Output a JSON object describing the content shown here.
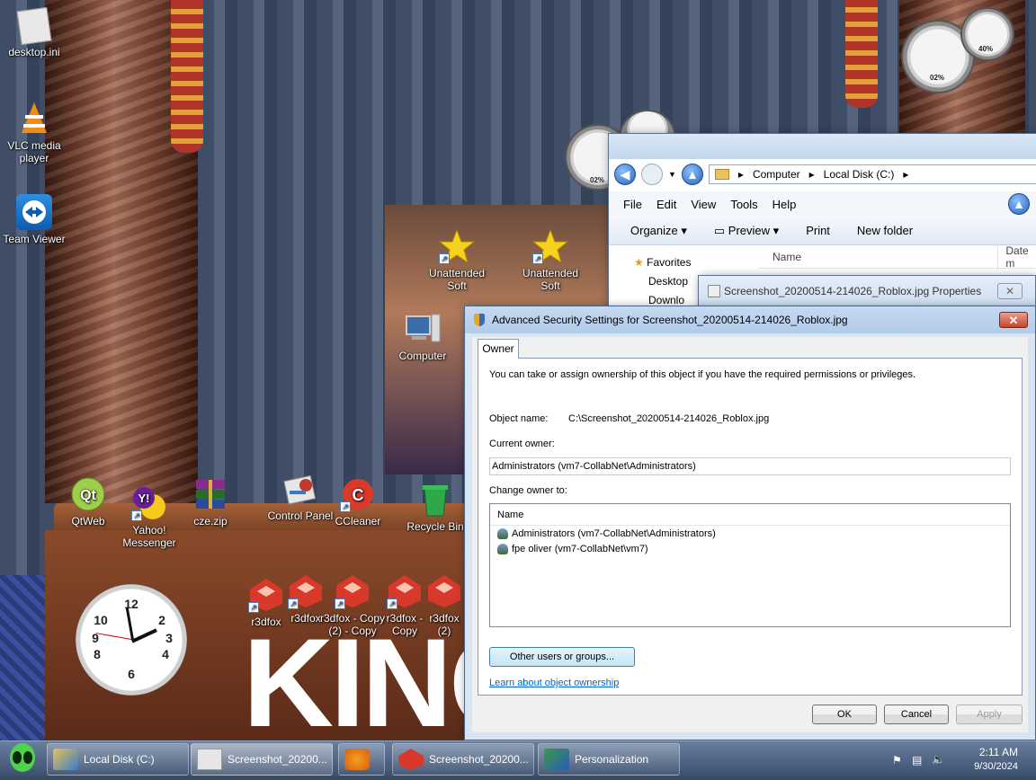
{
  "desktop": {
    "icons": [
      {
        "label": "desktop.ini"
      },
      {
        "label": "VLC media player"
      },
      {
        "label": "Team Viewer"
      },
      {
        "label": "Unattended Soft"
      },
      {
        "label": "Unattended Soft"
      },
      {
        "label": "Computer"
      },
      {
        "label": "QtWeb"
      },
      {
        "label": "Yahoo! Messenger"
      },
      {
        "label": "cze.zip"
      },
      {
        "label": "Control Panel"
      },
      {
        "label": "CCleaner"
      },
      {
        "label": "Recycle Bin"
      },
      {
        "label": "r3dfox"
      },
      {
        "label": "r3dfox"
      },
      {
        "label": "r3dfox - Copy (2) - Copy"
      },
      {
        "label": "r3dfox - Copy"
      },
      {
        "label": "r3dfox (2)"
      }
    ],
    "wallpaper_text": "KING",
    "gadgets": {
      "cpu_percent": "02%",
      "memory_percent": "40%",
      "cpu_percent_2": "02%"
    }
  },
  "explorer": {
    "breadcrumb": [
      "Computer",
      "Local Disk (C:)"
    ],
    "menu": [
      "File",
      "Edit",
      "View",
      "Tools",
      "Help"
    ],
    "toolbar": {
      "organize": "Organize",
      "preview": "Preview",
      "print": "Print",
      "new_folder": "New folder"
    },
    "nav": [
      "Favorites",
      "Desktop",
      "Downlo"
    ],
    "columns": [
      "Name",
      "Date m"
    ]
  },
  "properties": {
    "title": "Screenshot_20200514-214026_Roblox.jpg Properties"
  },
  "advanced": {
    "title": "Advanced Security Settings for Screenshot_20200514-214026_Roblox.jpg",
    "tab": "Owner",
    "intro": "You can take or assign ownership of this object if you have the required permissions or privileges.",
    "object_name_label": "Object name:",
    "object_name": "C:\\Screenshot_20200514-214026_Roblox.jpg",
    "current_owner_label": "Current owner:",
    "current_owner": "Administrators (vm7-CollabNet\\Administrators)",
    "change_owner_label": "Change owner to:",
    "list_header": "Name",
    "owners": [
      "Administrators (vm7-CollabNet\\Administrators)",
      "fpe oliver (vm7-CollabNet\\vm7)"
    ],
    "other_users_button": "Other users or groups...",
    "learn_link": "Learn about object ownership",
    "ok": "OK",
    "cancel": "Cancel",
    "apply": "Apply"
  },
  "taskbar": {
    "items": [
      "Local Disk (C:)",
      "Screenshot_20200...",
      "",
      "Screenshot_20200...",
      "Personalization"
    ],
    "time": "2:11 AM",
    "date": "9/30/2024"
  }
}
